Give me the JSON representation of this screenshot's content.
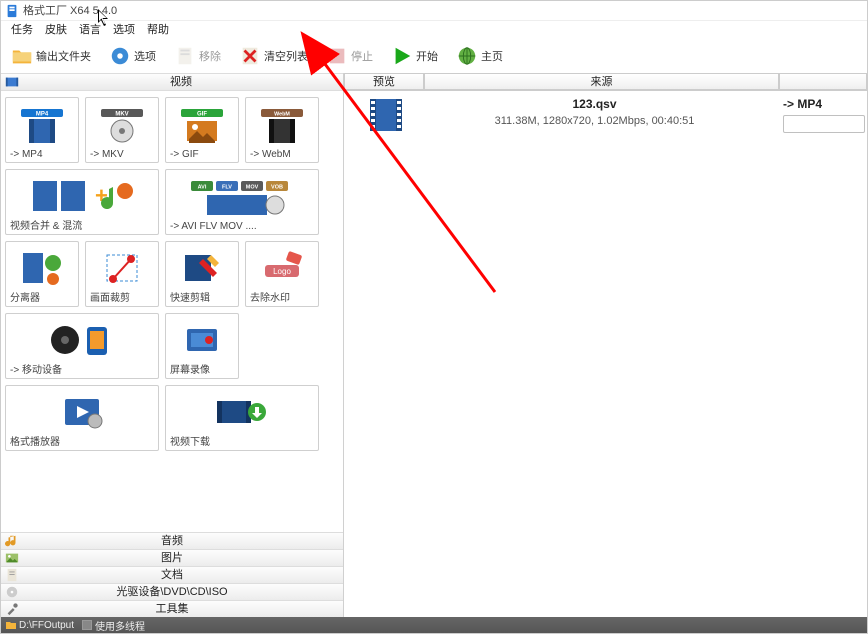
{
  "title": "格式工厂 X64 5.4.0",
  "menu": {
    "task": "任务",
    "skin": "皮肤",
    "lang": "语言",
    "options": "选项",
    "help": "帮助"
  },
  "toolbar": {
    "output_folder": "输出文件夹",
    "options": "选项",
    "remove": "移除",
    "clear_list": "清空列表",
    "stop": "停止",
    "start": "开始",
    "home": "主页"
  },
  "left": {
    "active_category": "视频",
    "categories": [
      "音频",
      "图片",
      "文档",
      "光驱设备\\DVD\\CD\\ISO",
      "工具集"
    ],
    "tiles": [
      {
        "label": "-> MP4",
        "w": 1,
        "icon": "mp4"
      },
      {
        "label": "-> MKV",
        "w": 1,
        "icon": "mkv"
      },
      {
        "label": "-> GIF",
        "w": 1,
        "icon": "gif"
      },
      {
        "label": "-> WebM",
        "w": 1,
        "icon": "webm"
      },
      {
        "label": "视频合并 & 混流",
        "w": 2,
        "icon": "merge"
      },
      {
        "label": "-> AVI FLV MOV ....",
        "w": 2,
        "icon": "multi"
      },
      {
        "label": "分离器",
        "w": 1,
        "icon": "split"
      },
      {
        "label": "画面裁剪",
        "w": 1,
        "icon": "crop"
      },
      {
        "label": "快速剪辑",
        "w": 1,
        "icon": "cut"
      },
      {
        "label": "去除水印",
        "w": 1,
        "icon": "nowm"
      },
      {
        "label": "-> 移动设备",
        "w": 2,
        "icon": "mobile"
      },
      {
        "label": "屏幕录像",
        "w": 1,
        "icon": "rec",
        "offset": 1
      },
      {
        "label": "格式播放器",
        "w": 2,
        "icon": "player"
      },
      {
        "label": "视频下载",
        "w": 2,
        "icon": "dl"
      }
    ]
  },
  "right": {
    "col_preview": "预览",
    "col_source": "来源",
    "file": {
      "name": "123.qsv",
      "meta": "311.38M, 1280x720, 1.02Mbps, 00:40:51",
      "out": "-> MP4"
    }
  },
  "status": {
    "output_path": "D:\\FFOutput",
    "checkbox_label": "使用多线程"
  }
}
